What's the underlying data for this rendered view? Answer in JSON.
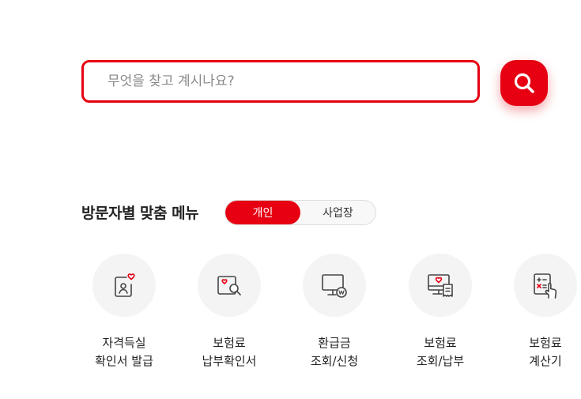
{
  "search": {
    "placeholder": "무엇을 찾고 계시나요?",
    "button_icon": "search-icon"
  },
  "section": {
    "title": "방문자별 맞춤 메뉴",
    "tabs": [
      {
        "label": "개인",
        "active": true
      },
      {
        "label": "사업장",
        "active": false
      }
    ]
  },
  "menu": [
    {
      "icon": "id-card-heart-icon",
      "line1": "자격득실",
      "line2": "확인서 발급"
    },
    {
      "icon": "document-search-icon",
      "line1": "보험료",
      "line2": "납부확인서"
    },
    {
      "icon": "monitor-won-icon",
      "line1": "환급금",
      "line2": "조회/신청"
    },
    {
      "icon": "computer-receipt-icon",
      "line1": "보험료",
      "line2": "조회/납부"
    },
    {
      "icon": "calculator-hand-icon",
      "line1": "보험료",
      "line2": "계산기"
    }
  ],
  "colors": {
    "accent": "#e60012"
  }
}
